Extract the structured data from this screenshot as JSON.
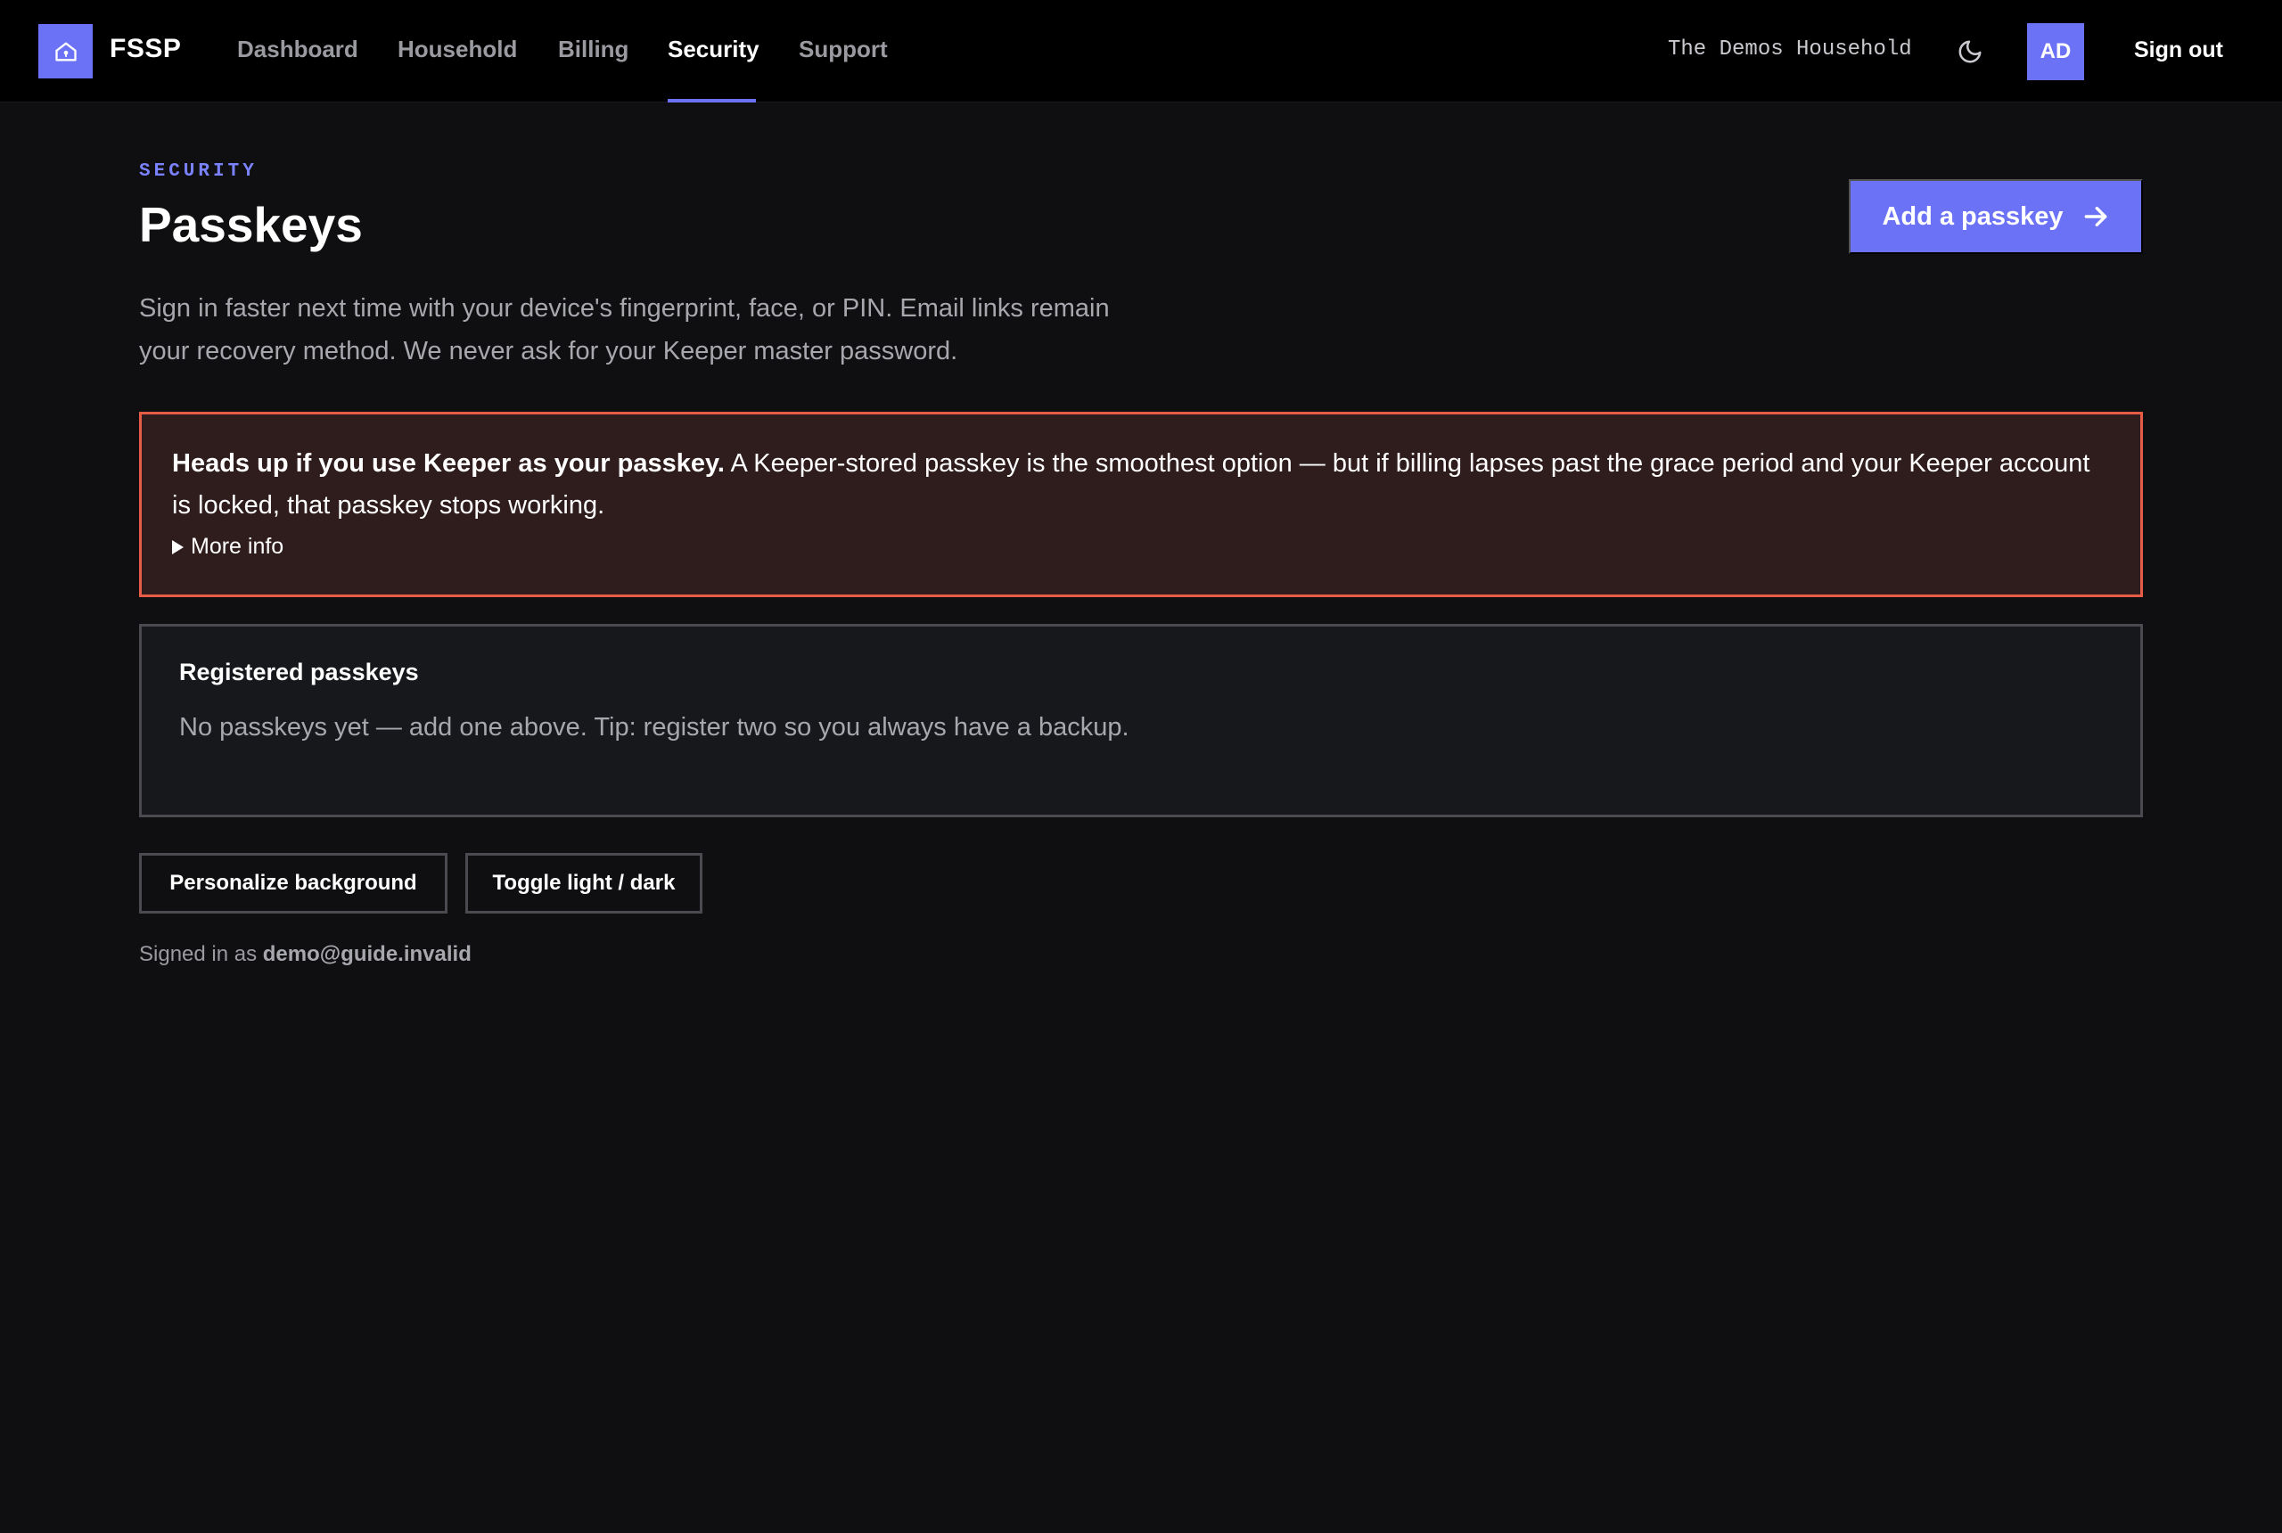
{
  "app": {
    "brand": "FSSP"
  },
  "nav": {
    "items": [
      {
        "label": "Dashboard"
      },
      {
        "label": "Household"
      },
      {
        "label": "Billing"
      },
      {
        "label": "Security",
        "active": true
      },
      {
        "label": "Support"
      }
    ]
  },
  "header_right": {
    "household_name": "The Demos Household",
    "theme_icon": "moon-icon",
    "avatar_initials": "AD",
    "signout_label": "Sign out"
  },
  "page": {
    "eyebrow": "SECURITY",
    "title": "Passkeys",
    "add_button_label": "Add a passkey",
    "add_button_icon": "arrow-right-icon",
    "lead": "Sign in faster next time with your device's fingerprint, face, or PIN. Email links remain your recovery method. We never ask for your Keeper master password."
  },
  "warning": {
    "heading": "Heads up if you use Keeper as your passkey.",
    "body": " A Keeper-stored passkey is the smoothest option — but if billing lapses past the grace period and your Keeper account is locked, that passkey stops working.",
    "more_info_label": "More info"
  },
  "registered": {
    "title": "Registered passkeys",
    "empty_text": "No passkeys yet — add one above. Tip: register two so you always have a backup."
  },
  "actions": {
    "personalize_label": "Personalize background",
    "toggle_theme_label": "Toggle light / dark"
  },
  "footer": {
    "signed_in_prefix": "Signed in as ",
    "email": "demo@guide.invalid"
  },
  "colors": {
    "accent": "#6b72f6",
    "warning_border": "#e65c46",
    "warning_bg": "#2f1c1c",
    "page_bg": "#0f0f11"
  }
}
